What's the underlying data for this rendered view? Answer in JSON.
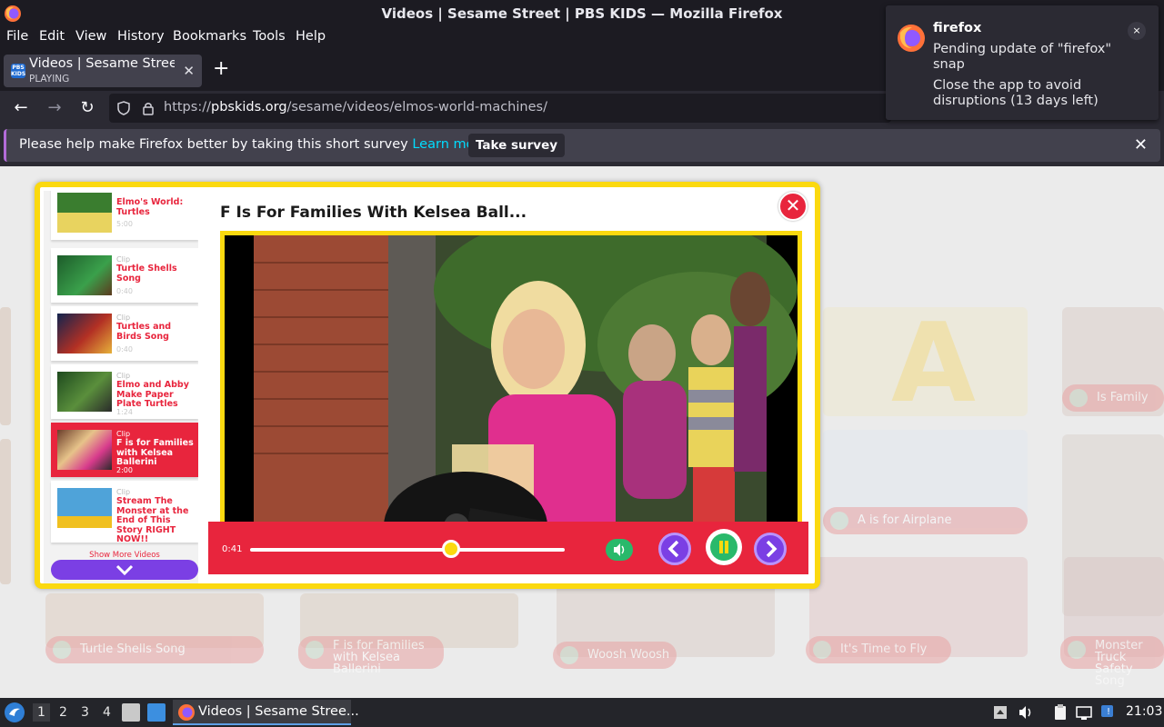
{
  "window": {
    "title": "Videos | Sesame Street | PBS KIDS — Mozilla Firefox"
  },
  "menubar": {
    "items": [
      "File",
      "Edit",
      "View",
      "History",
      "Bookmarks",
      "Tools",
      "Help"
    ]
  },
  "tab": {
    "title": "Videos | Sesame Street | PBS KIDS",
    "status": "PLAYING",
    "favicon": "PBS KIDS"
  },
  "navbar": {
    "url_scheme": "https://",
    "url_host": "pbskids.org",
    "url_path": "/sesame/videos/elmos-world-machines/"
  },
  "notification": {
    "message": "Please help make Firefox better by taking this short survey",
    "learn_more": "Learn more",
    "button": "Take survey"
  },
  "popup": {
    "app": "firefox",
    "body": "Pending update of \"firefox\" snap",
    "body2": "Close the app to avoid disruptions (13 days left)",
    "close": "×"
  },
  "player": {
    "title": "F Is For Families With Kelsea Ball...",
    "time": "0:41",
    "progress_percent": 64,
    "show_more": "Show More Videos",
    "playlist": [
      {
        "type": "Clip",
        "title": "Elmo's World: Turtles",
        "duration": "5:00",
        "active": false
      },
      {
        "type": "Clip",
        "title": "Turtle Shells Song",
        "duration": "0:40",
        "active": false
      },
      {
        "type": "Clip",
        "title": "Turtles and Birds Song",
        "duration": "0:40",
        "active": false
      },
      {
        "type": "Clip",
        "title": "Elmo and Abby Make Paper Plate Turtles",
        "duration": "1:24",
        "active": false
      },
      {
        "type": "Clip",
        "title": "F is for Families with Kelsea Ballerini",
        "duration": "2:00",
        "active": true
      },
      {
        "type": "Clip",
        "title": "Stream The Monster at the End of This Story RIGHT NOW!!",
        "duration": "",
        "active": false
      }
    ]
  },
  "background_cards": [
    "Is Family",
    "A is for Airplane",
    "Turtle Shells Song",
    "F is for Families with Kelsea Ballerini",
    "Woosh Woosh",
    "It's Time to Fly",
    "Monster Truck Safety Song"
  ],
  "taskbar": {
    "workspaces": [
      "1",
      "2",
      "3",
      "4"
    ],
    "task_title": "Videos | Sesame Stree...",
    "clock": "21:03"
  },
  "colors": {
    "accent_red": "#e8253d",
    "accent_yellow": "#fbd90f",
    "accent_purple": "#7b3fe4",
    "accent_green": "#29b96b"
  }
}
